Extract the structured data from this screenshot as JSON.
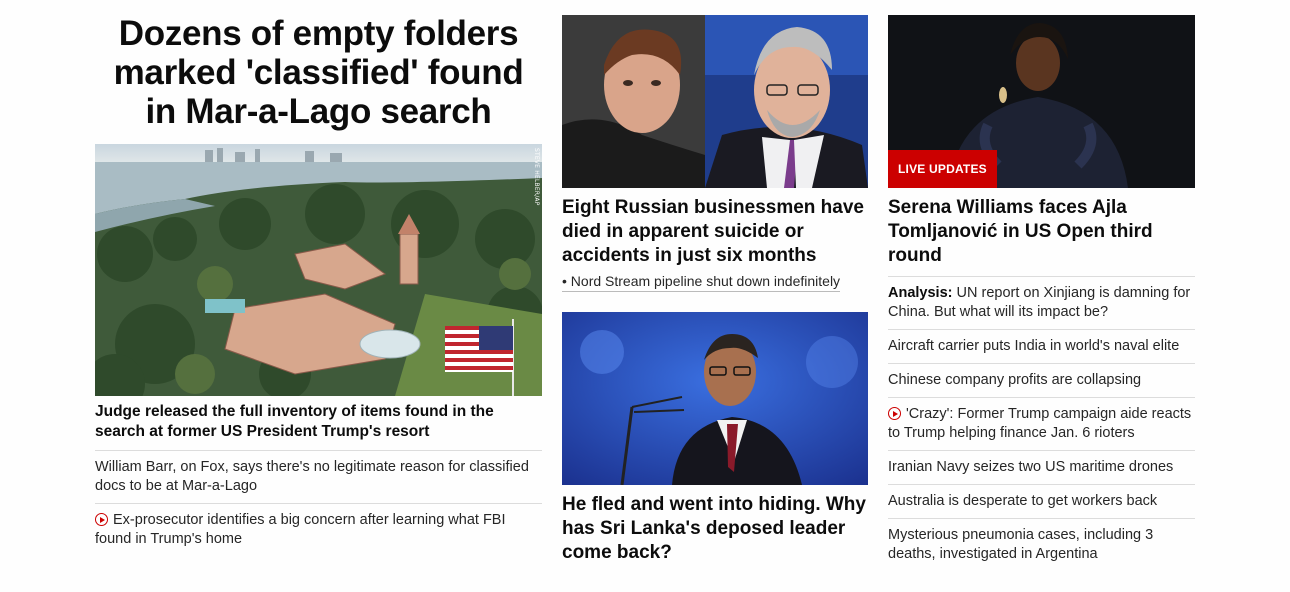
{
  "lead": {
    "headline": "Dozens of empty folders marked 'classified' found in Mar-a-Lago search",
    "image_alt": "Aerial view of Mar-a-Lago resort",
    "photo_credit": "STEVE HELBER/AP",
    "caption": "Judge released the full inventory of items found in the search at former US President Trump's resort",
    "related": [
      {
        "text": "William Barr, on Fox, says there's no legitimate reason for classified docs to be at Mar-a-Lago",
        "video": false
      },
      {
        "text": "Ex-prosecutor identifies a big concern after learning what FBI found in Trump's home",
        "video": true
      }
    ]
  },
  "russia": {
    "headline": "Eight Russian businessmen have died in apparent suicide or accidents in just six months",
    "sub_link": "• Nord Stream pipeline shut down indefinitely"
  },
  "srilanka": {
    "headline": "He fled and went into hiding. Why has Sri Lanka's deposed leader come back?"
  },
  "serena": {
    "badge": "LIVE UPDATES",
    "headline": "Serena Williams faces Ajla Tomljanović in US Open third round",
    "list": [
      {
        "label": "Analysis:",
        "text": " UN report on Xinjiang is damning for China. But what will its impact be?",
        "video": false
      },
      {
        "label": "",
        "text": "Aircraft carrier puts India in world's naval elite",
        "video": false
      },
      {
        "label": "",
        "text": "Chinese company profits are collapsing",
        "video": false
      },
      {
        "label": "",
        "text": "'Crazy': Former Trump campaign aide reacts to Trump helping finance Jan. 6 rioters",
        "video": true
      },
      {
        "label": "",
        "text": "Iranian Navy seizes two US maritime drones",
        "video": false
      },
      {
        "label": "",
        "text": "Australia is desperate to get workers back",
        "video": false
      },
      {
        "label": "",
        "text": "Mysterious pneumonia cases, including 3 deaths, investigated in Argentina",
        "video": false
      }
    ]
  },
  "colors": {
    "accent_red": "#cc0000",
    "divider": "#dcdcdc",
    "text": "#0c0c0c"
  }
}
